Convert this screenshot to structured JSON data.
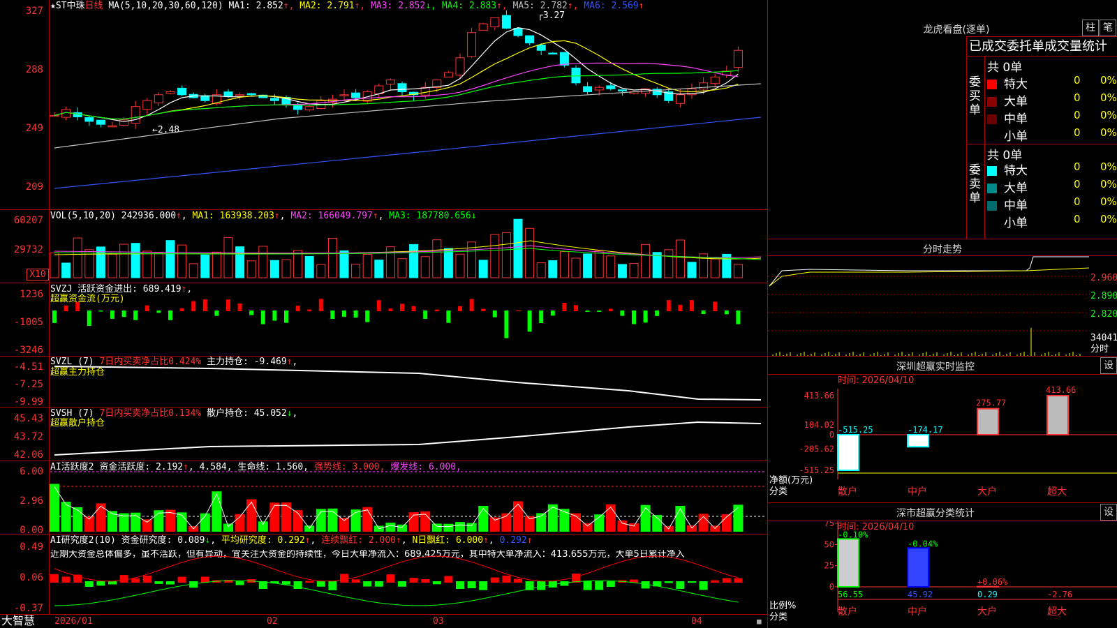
{
  "header": {
    "star": "★",
    "stock_name": "ST中珠",
    "period": "日线",
    "ma_params": "MA(5,10,20,30,60,120)",
    "ma": [
      {
        "label": "MA1: 2.852",
        "arrow": "↑",
        "color": "#ffffff"
      },
      {
        "label": "MA2: 2.791",
        "arrow": "↑",
        "color": "#ffff00"
      },
      {
        "label": "MA3: 2.852",
        "arrow": "↓",
        "color": "#ff44ff"
      },
      {
        "label": "MA4: 2.883",
        "arrow": "↑",
        "color": "#00ff00"
      },
      {
        "label": "MA5: 2.782",
        "arrow": "↑",
        "color": "#c0c0c0"
      },
      {
        "label": "MA6: 2.569",
        "arrow": "↑",
        "color": "#3355ff"
      }
    ],
    "high_label": "3.27",
    "low_label": "2.48"
  },
  "axes": {
    "price": [
      "327",
      "288",
      "249",
      "209"
    ],
    "vol": [
      "60207",
      "29732",
      "X10"
    ],
    "svzj": [
      "1236",
      "-1005",
      "-3246"
    ],
    "svzl": [
      "-4.51",
      "-7.25",
      "-9.99"
    ],
    "svsh": [
      "45.43",
      "43.72",
      "42.06"
    ],
    "active": [
      "6.00",
      "2.96",
      "0.00"
    ],
    "research": [
      "0.49",
      "0.06",
      "-0.37"
    ]
  },
  "vol_header": {
    "params": "VOL(5,10,20)",
    "value": "242936.000",
    "ma1": "MA1: 163938.203",
    "ma2": "MA2: 166049.797",
    "ma3": "MA3: 187780.656"
  },
  "svzj_header": {
    "title": "SVZJ  活跃资金进出:",
    "value": "689.419",
    "sub": "超赢资金流(万元)"
  },
  "svzl_header": {
    "title": "SVZL (7)",
    "ratio": "7日内买卖净占比0.424%",
    "hold": "主力持仓: -9.469",
    "sub": "超赢主力持仓"
  },
  "svsh_header": {
    "title": "SVSH (7)",
    "ratio": "7日内买卖净占比0.134%",
    "hold": "散户持仓: 45.052",
    "sub": "超赢散户持仓"
  },
  "active_header": {
    "title": "AI活跃度2",
    "activity": "资金活跃度: 2.192",
    "v2": "4.584,",
    "life": "生命线: 1.560,",
    "strong": "强势线: 3.000,",
    "burst": "爆发线: 6.000,"
  },
  "research_header": {
    "title": "AI研究度2(10)",
    "r1": "资金研究度: 0.089",
    "r2": "平均研究度: 0.292",
    "r3": "连续飘红: 2.000",
    "r4": "N日飘红: 6.000",
    "r5": "0.292"
  },
  "research_note": "近期大资金总体偏多，虽不活跃，但有异动，宜关注大资金的持续性，今日大单净流入：689.425万元，其中特大单净流入：413.655万元，大单5日累计净入",
  "footer": {
    "brand": "大智慧",
    "dates": [
      "2026/01",
      "02",
      "03",
      "04"
    ]
  },
  "longhu": {
    "title": "龙虎看盘(逐单)",
    "btn1": "柱",
    "btn2": "笔",
    "tabs": "已成交委托单成交量统计",
    "buy_label": "委买单",
    "sell_label": "委卖单",
    "buy_total": "共 0单",
    "sell_total": "共 0单",
    "buy_rows": [
      {
        "name": "特大",
        "count": "0",
        "pct": "0%",
        "color": "#ff0000"
      },
      {
        "name": "大单",
        "count": "0",
        "pct": "0%",
        "color": "#8b0000"
      },
      {
        "name": "中单",
        "count": "0",
        "pct": "0%",
        "color": "#6b0000"
      },
      {
        "name": "小单",
        "count": "0",
        "pct": "0%",
        "color": "#000000"
      }
    ],
    "sell_rows": [
      {
        "name": "特大",
        "count": "0",
        "pct": "0%",
        "color": "#00ffff"
      },
      {
        "name": "大单",
        "count": "0",
        "pct": "0%",
        "color": "#008b8b"
      },
      {
        "name": "中单",
        "count": "0",
        "pct": "0%",
        "color": "#006b6b"
      },
      {
        "name": "小单",
        "count": "0",
        "pct": "0%",
        "color": "#000000"
      }
    ]
  },
  "intraday": {
    "title": "分时走势",
    "p1": "2.960",
    "p2": "2.890",
    "p3": "2.820",
    "vol": "34041",
    "vol_unit": "分时"
  },
  "monitor": {
    "title": "深圳超赢实时监控",
    "settings": "设",
    "time": "时间: 2026/04/10",
    "y": [
      "413.66",
      "104.02",
      "0",
      "-205.62",
      "-515.25"
    ],
    "ylabel": "净额(万元)",
    "xlabel": "分类",
    "cats": [
      "散户",
      "中户",
      "大户",
      "超大"
    ],
    "values": [
      -515.25,
      -174.17,
      275.77,
      413.66
    ],
    "value_labels": [
      "-515.25",
      "-174.17",
      "275.77",
      "413.66"
    ]
  },
  "classify": {
    "title": "深市超赢分类统计",
    "settings": "设",
    "time": "时间: 2026/04/10",
    "y": [
      "75",
      "50",
      "25",
      "0"
    ],
    "ylabel": "比例%",
    "xlabel": "分类",
    "cats": [
      "散户",
      "中户",
      "大户",
      "超大"
    ],
    "values": [
      56.55,
      45.92,
      0.29,
      -2.76
    ],
    "value_labels": [
      "56.55",
      "45.92",
      "0.29",
      "-2.76"
    ],
    "changes": [
      "-0.10%",
      "-0.04%",
      "+0.06%",
      ""
    ]
  },
  "chart_data": [
    {
      "type": "bar",
      "title": "深圳超赢实时监控",
      "ylabel": "净额(万元)",
      "xlabel": "分类",
      "categories": [
        "散户",
        "中户",
        "大户",
        "超大"
      ],
      "values": [
        -515.25,
        -174.17,
        275.77,
        413.66
      ],
      "ylim": [
        -515.25,
        413.66
      ]
    },
    {
      "type": "bar",
      "title": "深市超赢分类统计",
      "ylabel": "比例%",
      "xlabel": "分类",
      "categories": [
        "散户",
        "中户",
        "大户",
        "超大"
      ],
      "values": [
        56.55,
        45.92,
        0.29,
        -2.76
      ],
      "ylim": [
        0,
        75
      ]
    }
  ]
}
